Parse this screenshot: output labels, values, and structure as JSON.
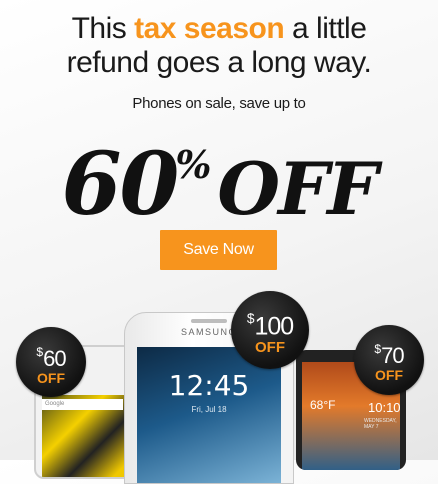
{
  "headline": {
    "line1_prefix": "This ",
    "line1_accent": "tax season",
    "line1_suffix": " a little",
    "line2": "refund goes a long way."
  },
  "subheadline": "Phones on sale, save up to",
  "big_offer": {
    "number": "60",
    "percent": "%",
    "word": "OFF"
  },
  "cta": {
    "label": "Save Now"
  },
  "phones": {
    "left": {
      "search_hint": "Google"
    },
    "middle": {
      "brand": "SAMSUNG",
      "time": "12:45",
      "date": "Fri, Jul 18"
    },
    "right": {
      "temperature": "68°F",
      "clock": "10:10",
      "date": "WEDNESDAY, MAY 7"
    }
  },
  "badges": [
    {
      "currency": "$",
      "amount": "60",
      "off": "OFF"
    },
    {
      "currency": "$",
      "amount": "100",
      "off": "OFF"
    },
    {
      "currency": "$",
      "amount": "70",
      "off": "OFF"
    }
  ],
  "colors": {
    "accent": "#f7941d",
    "text": "#1a1a1a",
    "badge": "#1a1a1a"
  }
}
